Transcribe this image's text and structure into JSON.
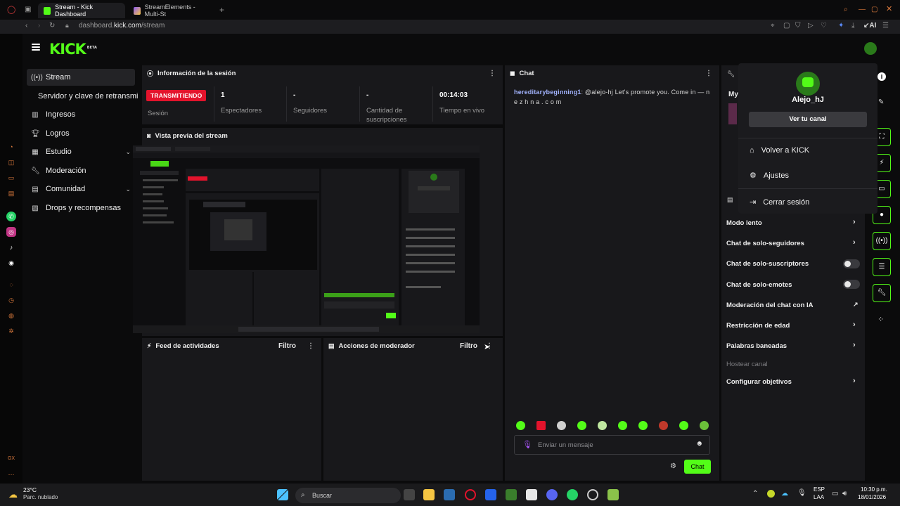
{
  "browser": {
    "tabs": [
      {
        "title": "Stream - Kick Dashboard",
        "active": true
      },
      {
        "title": "StreamElements - Multi-St",
        "active": false
      }
    ],
    "new_tab_icon": "plus-icon",
    "url_prefix": "dashboard.",
    "url_domain": "kick.com",
    "url_path": "/stream",
    "ai_label": "AI"
  },
  "sidebar": {
    "items": [
      {
        "label": "Stream",
        "icon": "broadcast-icon",
        "active": true
      },
      {
        "label": "Servidor y clave de retransmi",
        "icon": "",
        "sub": true
      },
      {
        "label": "Ingresos",
        "icon": "chart-icon"
      },
      {
        "label": "Logros",
        "icon": "trophy-icon"
      },
      {
        "label": "Estudio",
        "icon": "layout-icon",
        "expandable": true
      },
      {
        "label": "Moderación",
        "icon": "wrench-icon"
      },
      {
        "label": "Comunidad",
        "icon": "community-icon",
        "expandable": true
      },
      {
        "label": "Drops y recompensas",
        "icon": "drops-icon"
      }
    ]
  },
  "session": {
    "title": "Información de la sesión",
    "badge": "TRANSMITIENDO",
    "stats": [
      {
        "value": "",
        "label": "Sesión"
      },
      {
        "value": "1",
        "label": "Espectadores"
      },
      {
        "value": "-",
        "label": "Seguidores"
      },
      {
        "value": "-",
        "label": "Cantidad de suscripciones"
      },
      {
        "value": "00:14:03",
        "label": "Tiempo en vivo"
      }
    ]
  },
  "preview": {
    "title": "Vista previa del stream"
  },
  "activity": {
    "title": "Feed de actividades",
    "filter": "Filtro"
  },
  "modactions": {
    "title": "Acciones de moderador",
    "filter": "Filtro"
  },
  "chat": {
    "title": "Chat",
    "messages": [
      {
        "user": "hereditarybeginning1",
        "text": ": @alejo-hj Let's promote you. Come in — n e z h n a . c o m"
      }
    ],
    "input_placeholder": "Enviar un mensaje",
    "send_label": "Chat"
  },
  "right_panel": {
    "header_partial": "My",
    "rows": [
      {
        "label": "Modo lento",
        "control": "chevron"
      },
      {
        "label": "Chat de solo-seguidores",
        "control": "chevron"
      },
      {
        "label": "Chat de solo-suscriptores",
        "control": "toggle"
      },
      {
        "label": "Chat de solo-emotes",
        "control": "toggle"
      },
      {
        "label": "Moderación del chat con IA",
        "control": "external"
      },
      {
        "label": "Restricción de edad",
        "control": "chevron"
      },
      {
        "label": "Palabras baneadas",
        "control": "chevron"
      },
      {
        "label": "Hostear canal",
        "control": "none",
        "disabled": true
      },
      {
        "label": "Configurar objetivos",
        "control": "chevron"
      }
    ]
  },
  "user_menu": {
    "username": "Alejo_hJ",
    "view_channel": "Ver tu canal",
    "items": [
      {
        "label": "Volver a KICK",
        "icon": "home-icon"
      },
      {
        "label": "Ajustes",
        "icon": "gear-icon"
      },
      {
        "label": "Cerrar sesión",
        "icon": "logout-icon"
      }
    ]
  },
  "taskbar": {
    "weather_temp": "23°C",
    "weather_desc": "Parc. nublado",
    "search_label": "Buscar",
    "lang_1": "ESP",
    "lang_2": "LAA",
    "time": "10:30 p.m.",
    "date": "18/01/2026"
  },
  "colors": {
    "accent": "#53fc18",
    "live": "#e3132c",
    "panel": "#18181b",
    "bg": "#0b0b0c"
  }
}
